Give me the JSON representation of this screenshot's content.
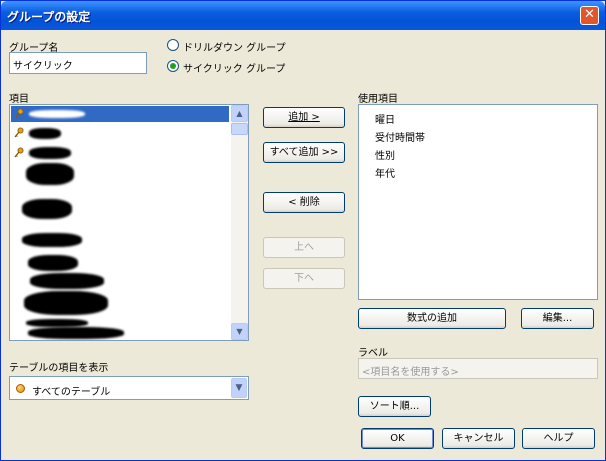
{
  "window": {
    "title": "グループの設定",
    "close_glyph": "✕"
  },
  "group_name": {
    "label": "グループ名",
    "value": "サイクリック"
  },
  "group_type": {
    "options": [
      {
        "label": "ドリルダウン グループ",
        "selected": false
      },
      {
        "label": "サイクリック グループ",
        "selected": true
      }
    ]
  },
  "items": {
    "label": "項目"
  },
  "used_items": {
    "label": "使用項目",
    "values": [
      "曜日",
      "受付時間帯",
      "性別",
      "年代"
    ]
  },
  "buttons": {
    "add": "追加 >",
    "add_all": "すべて追加 >>",
    "remove": "< 削除",
    "up": "上へ",
    "down": "下へ",
    "add_formula": "数式の追加",
    "edit": "編集...",
    "sort": "ソート順...",
    "ok": "OK",
    "cancel": "キャンセル",
    "help": "ヘルプ"
  },
  "table_filter": {
    "label": "テーブルの項目を表示",
    "value": "すべてのテーブル"
  },
  "label_field": {
    "label": "ラベル",
    "placeholder": "<項目名を使用する>"
  },
  "colors": {
    "titlebar": "#0a5ce0",
    "selection": "#316ac5",
    "dialog_bg": "#ece9d8"
  },
  "icons": {
    "field_item": "key-icon",
    "table": "orange-circle-icon"
  }
}
